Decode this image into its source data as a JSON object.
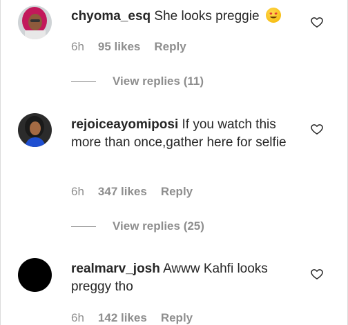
{
  "comments": [
    {
      "username": "chyoma_esq",
      "text": " She looks preggie ",
      "emoji": "heart-eyes-emoji",
      "time": "6h",
      "likes": "95 likes",
      "reply": "Reply",
      "view_replies": "View replies (11)"
    },
    {
      "username": "rejoiceayomiposi",
      "text": " If you watch this more than once,gather here for selfie",
      "time": "6h",
      "likes": "347 likes",
      "reply": "Reply",
      "view_replies": "View replies (25)"
    },
    {
      "username": "realmarv_josh",
      "text": " Awww Kahfi looks preggy tho",
      "time": "6h",
      "likes": "142 likes",
      "reply": "Reply"
    }
  ],
  "icons": {
    "like": "heart-outline-icon"
  },
  "colors": {
    "text": "#262626",
    "muted": "#8e8e8e",
    "divider": "#dbdbdb"
  }
}
